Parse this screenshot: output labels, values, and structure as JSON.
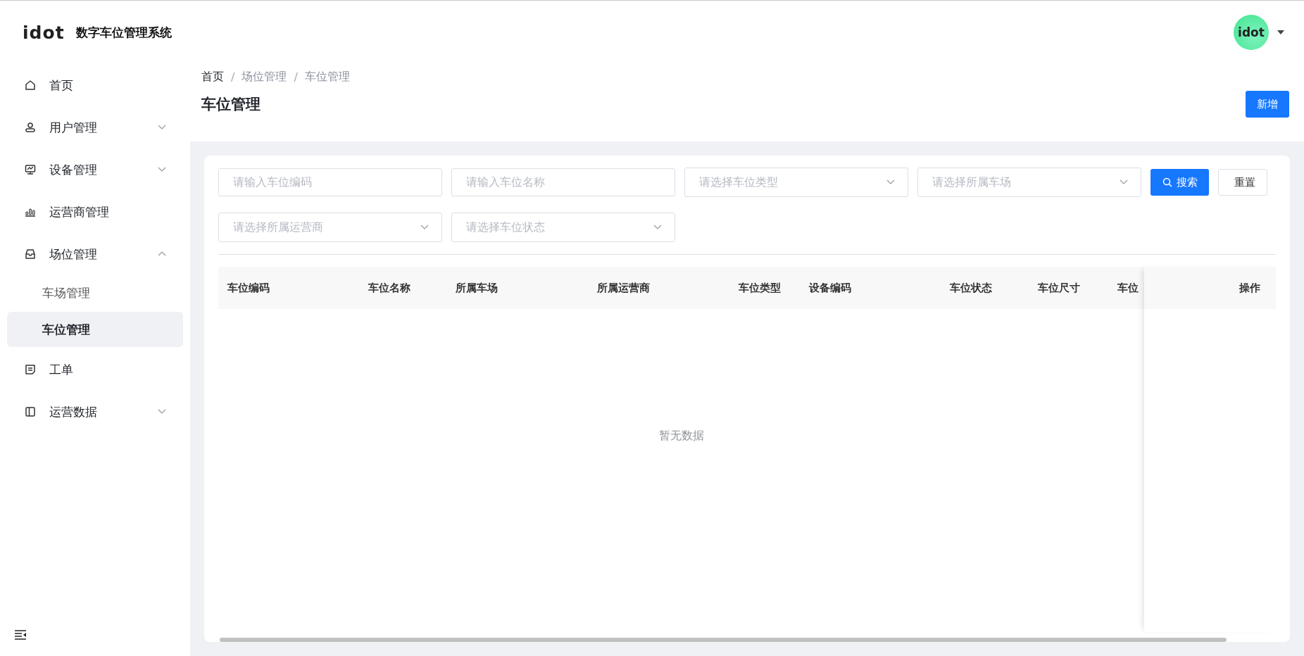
{
  "header": {
    "logo": "idot",
    "title": "数字车位管理系统",
    "avatar": "idot"
  },
  "sidebar": {
    "items": [
      {
        "label": "首页",
        "kind": "link"
      },
      {
        "label": "用户管理",
        "kind": "group",
        "expanded": false
      },
      {
        "label": "设备管理",
        "kind": "group",
        "expanded": false
      },
      {
        "label": "运营商管理",
        "kind": "link"
      },
      {
        "label": "场位管理",
        "kind": "group",
        "expanded": true,
        "children": [
          {
            "label": "车场管理",
            "selected": false
          },
          {
            "label": "车位管理",
            "selected": true
          }
        ]
      },
      {
        "label": "工单",
        "kind": "link"
      },
      {
        "label": "运营数据",
        "kind": "group",
        "expanded": false
      }
    ]
  },
  "breadcrumb": {
    "separator": "/",
    "items": [
      "首页",
      "场位管理",
      "车位管理"
    ]
  },
  "page_title": "车位管理",
  "add_button": "新增",
  "filters": [
    {
      "kind": "input",
      "placeholder": "请输入车位编码"
    },
    {
      "kind": "input",
      "placeholder": "请输入车位名称"
    },
    {
      "kind": "select",
      "placeholder": "请选择车位类型"
    },
    {
      "kind": "select",
      "placeholder": "请选择所属车场"
    },
    {
      "kind": "select",
      "placeholder": "请选择所属运营商"
    },
    {
      "kind": "select",
      "placeholder": "请选择车位状态"
    }
  ],
  "search_button": "搜索",
  "reset_button": "重置",
  "table": {
    "columns": [
      "车位编码",
      "车位名称",
      "所属车场",
      "所属运营商",
      "车位类型",
      "设备编码",
      "车位状态",
      "车位尺寸",
      "车位"
    ],
    "fixed_column": "操作",
    "empty_text": "暂无数据"
  }
}
